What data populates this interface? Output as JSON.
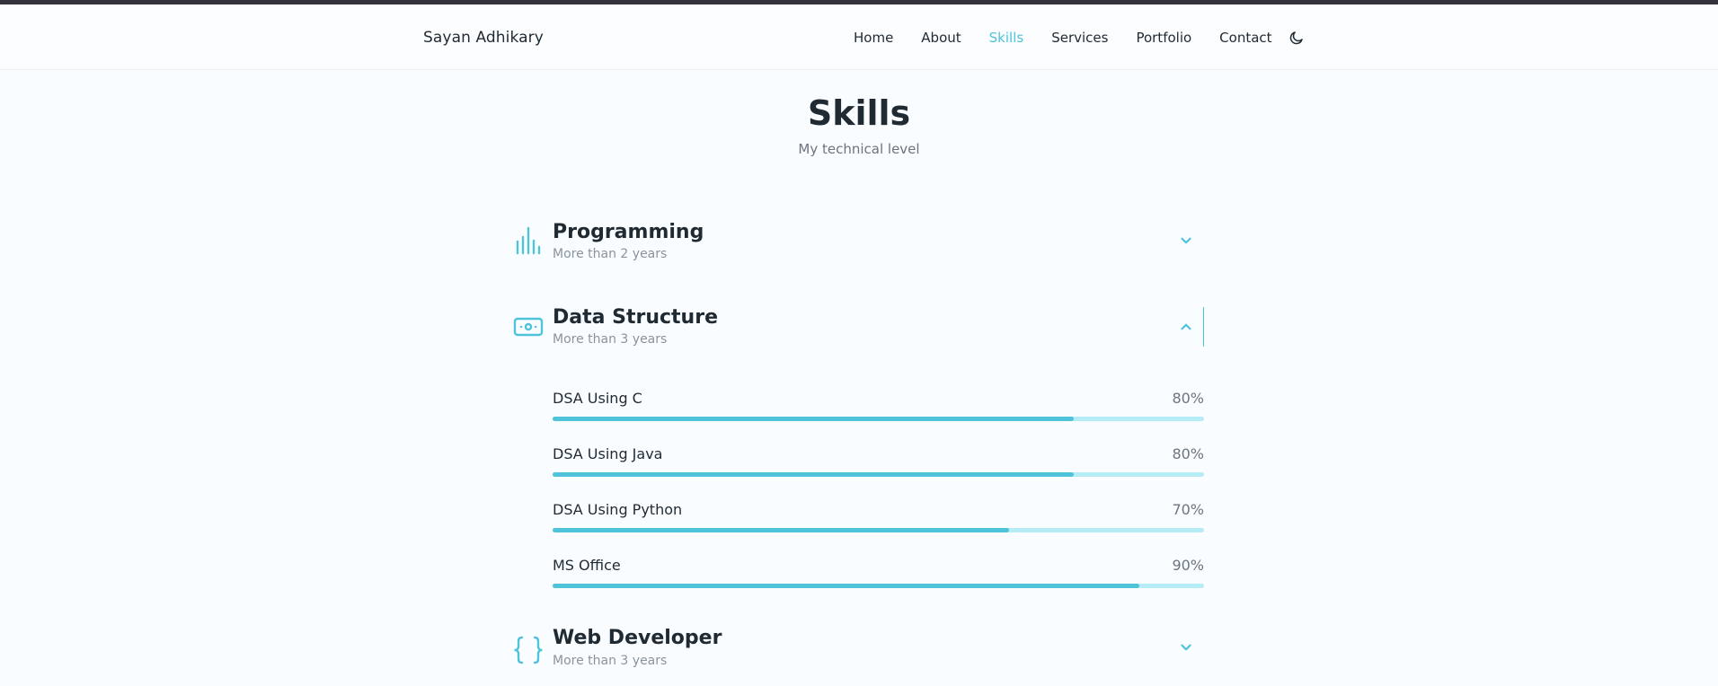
{
  "header": {
    "logo": "Sayan Adhikary",
    "nav": [
      "Home",
      "About",
      "Skills",
      "Services",
      "Portfolio",
      "Contact"
    ],
    "active_nav": "Skills",
    "theme_toggle_icon": "moon-icon"
  },
  "section": {
    "title": "Skills",
    "subtitle": "My technical level"
  },
  "groups": [
    {
      "title": "Programming",
      "subtitle": "More than 2 years",
      "icon": "bar-chart-icon",
      "expanded": false
    },
    {
      "title": "Data Structure",
      "subtitle": "More than 3 years",
      "icon": "cash-icon",
      "expanded": true,
      "skills": [
        {
          "name": "DSA Using C",
          "percent": "80%",
          "level": 0.8
        },
        {
          "name": "DSA Using Java",
          "percent": "80%",
          "level": 0.8
        },
        {
          "name": "DSA Using Python",
          "percent": "70%",
          "level": 0.7
        },
        {
          "name": "MS Office",
          "percent": "90%",
          "level": 0.9
        }
      ]
    },
    {
      "title": "Web Developer",
      "subtitle": "More than 3 years",
      "icon": "braces-icon",
      "expanded": false
    }
  ],
  "colors": {
    "accent": "#4fc3d9",
    "accent_light": "#b6ecf5",
    "text": "#1f2a33",
    "muted": "#8a949c",
    "topbar": "#34323c"
  }
}
